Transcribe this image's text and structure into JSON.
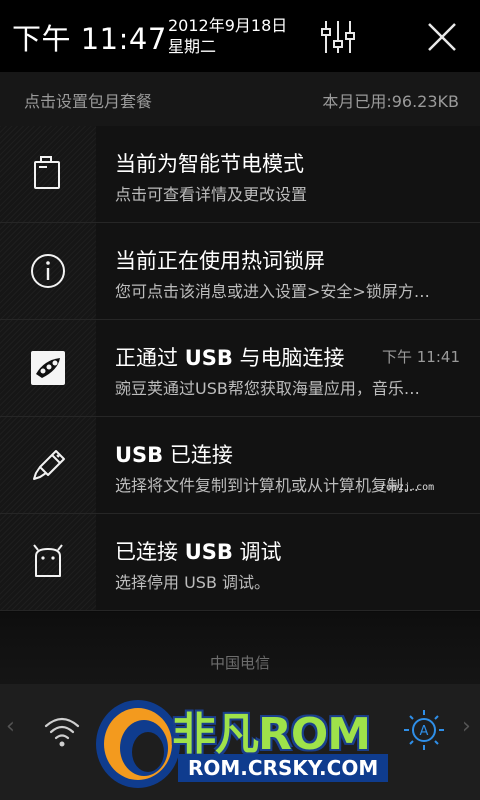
{
  "header": {
    "time": "下午 11:47",
    "date": "2012年9月18日",
    "weekday": "星期二",
    "settings_icon": "sliders-icon",
    "close_icon": "close-icon"
  },
  "data_bar": {
    "left_text": "点击设置包月套餐",
    "right_text": "本月已用:96.23KB"
  },
  "notifications": [
    {
      "icon": "battery-icon",
      "title": "当前为智能节电模式",
      "subtitle": "点击可查看详情及更改设置",
      "time": ""
    },
    {
      "icon": "info-icon",
      "title": "当前正在使用热词锁屏",
      "subtitle": "您可点击该消息或进入设置>安全>锁屏方…",
      "time": ""
    },
    {
      "icon": "wandoujia-icon",
      "title_pre": "正通过 ",
      "title_bold": "USB",
      "title_post": " 与电脑连接",
      "subtitle": "豌豆荚通过USB帮您获取海量应用，音乐…",
      "time": "下午 11:41"
    },
    {
      "icon": "usb-icon",
      "title_bold": "USB",
      "title_post": " 已连接",
      "subtitle": "选择将文件复制到计算机或从计算机复制…",
      "time": ""
    },
    {
      "icon": "android-debug-icon",
      "title_pre": "已连接 ",
      "title_bold": "USB",
      "title_post": " 调试",
      "subtitle": "选择停用 USB 调试。",
      "time": ""
    }
  ],
  "carrier": "中国电信",
  "watermarks": {
    "brand": "非凡ROM",
    "url": "ROM.CRSKY.COM",
    "small": "romzj.com"
  },
  "colors": {
    "brand_green": "#9fe24a",
    "brand_blue": "#0f3c8e",
    "toggle_active": "#2f8fe8"
  }
}
